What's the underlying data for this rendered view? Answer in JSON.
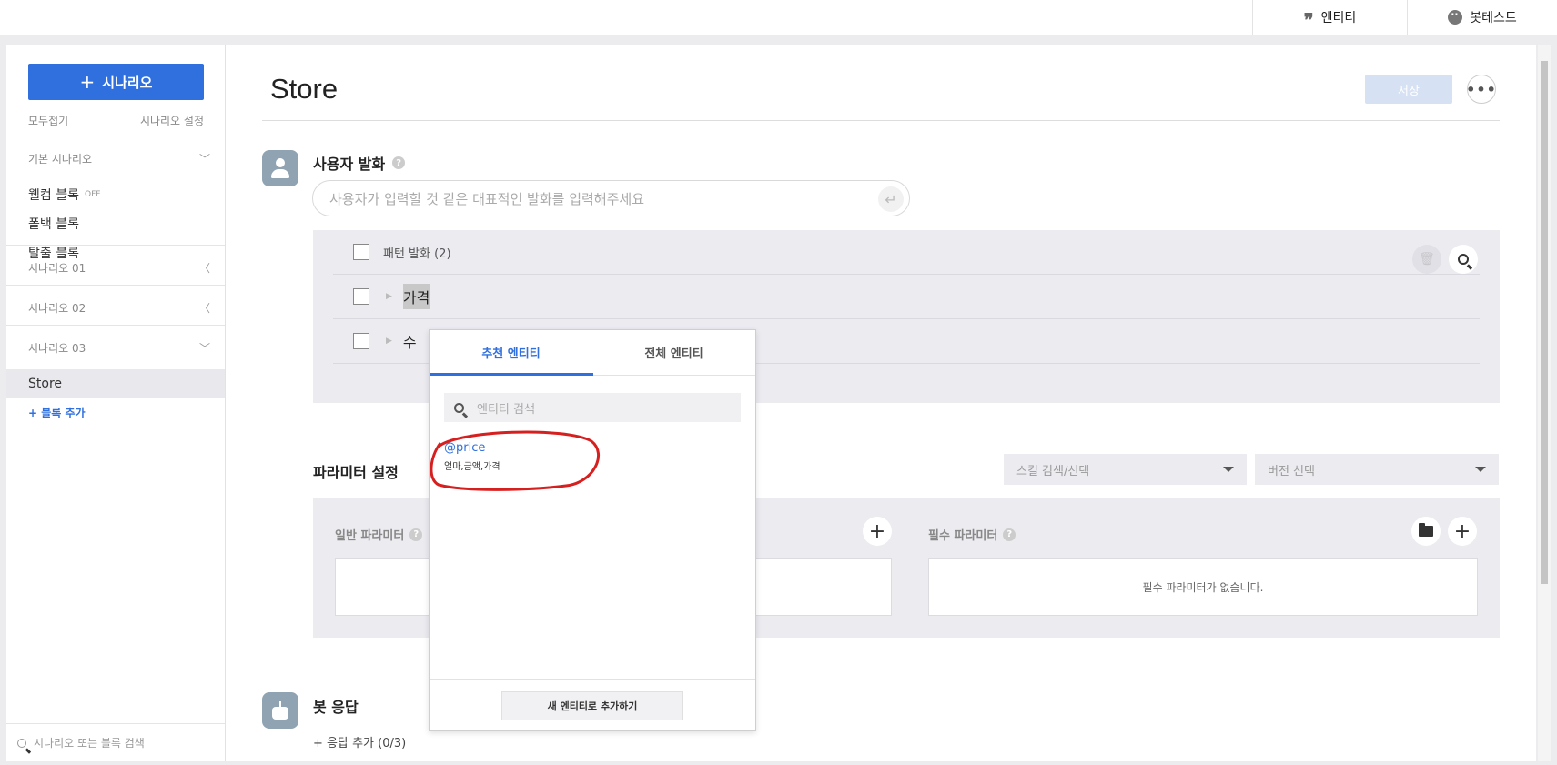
{
  "topbar": {
    "entity_tab": "엔티티",
    "bottest_tab": "봇테스트"
  },
  "sidebar": {
    "add_scenario": "시나리오",
    "collapse_all": "모두접기",
    "scenario_settings": "시나리오 설정",
    "basic_section": "기본 시나리오",
    "welcome_block": "웰컴 블록",
    "welcome_status": "OFF",
    "fallback_block": "폴백 블록",
    "exit_block": "탈출 블록",
    "scenario01": "시나리오 01",
    "scenario02": "시나리오 02",
    "scenario03": "시나리오 03",
    "active_block": "Store",
    "add_block": "+ 블록 추가",
    "search_placeholder": "시나리오 또는 블록 검색"
  },
  "main": {
    "title": "Store",
    "save": "저장",
    "more": "•••",
    "user_utterance_label": "사용자 발화",
    "utterance_placeholder": "사용자가 입력할 것 같은 대표적인 발화를 입력해주세요",
    "pattern_header": "패턴 발화 (2)",
    "patterns": [
      "가격",
      "수"
    ],
    "param_settings_label": "파라미터 설정",
    "skill_select": "스킬 검색/선택",
    "version_select": "버전 선택",
    "general_params": "일반 파라미터",
    "required_params": "필수 파라미터",
    "no_required_params": "필수 파라미터가 없습니다.",
    "bot_response_label": "봇 응답",
    "add_response": "+ 응답 추가 (0/3)"
  },
  "popup": {
    "tab_recommended": "추천 엔티티",
    "tab_all": "전체 엔티티",
    "search_placeholder": "엔티티 검색",
    "entity_name": "@price",
    "entity_synonyms": "얼마,금액,가격",
    "add_new_entity": "새 엔티티로 추가하기"
  },
  "colors": {
    "accent": "#2f6fde",
    "annotation_circle": "#d62020"
  },
  "icons": [
    "quote-icon",
    "chat-bubble-icon",
    "plus-icon",
    "chevron-down-icon",
    "chevron-left-icon",
    "search-icon",
    "trash-icon",
    "enter-icon",
    "folder-icon",
    "user-avatar-icon",
    "bot-avatar-icon",
    "more-icon"
  ]
}
